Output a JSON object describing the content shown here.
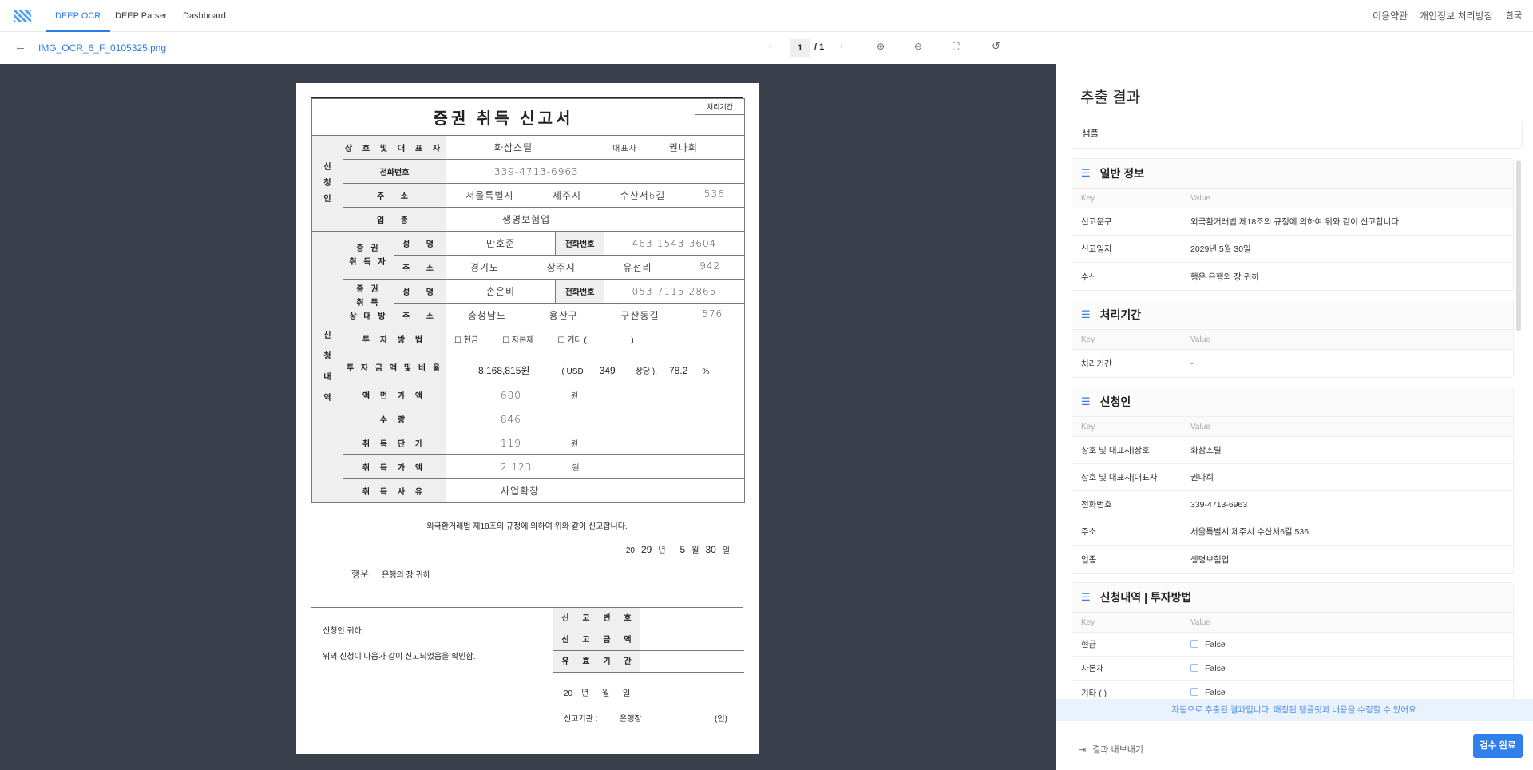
{
  "nav": {
    "tabs": [
      "DEEP OCR",
      "DEEP Parser",
      "Dashboard"
    ],
    "terms": "이용약관",
    "privacy": "개인정보 처리방침",
    "lang": "한국"
  },
  "toolbar": {
    "filename": "IMG_OCR_6_F_0105325.png",
    "page": "1",
    "total": "/ 1"
  },
  "doc": {
    "title": "증권 취득 신고서",
    "period_label": "처리기간",
    "applicant_group": "신\n청\n인",
    "detail_group": "신\n\n청\n\n내\n\n역",
    "l_company": "상 호 및 대 표 자",
    "company": "화삼스틸",
    "rep_label": "대표자",
    "rep": "권나희",
    "l_phone": "전화번호",
    "phone": "339-4713-6963",
    "l_addr": "주  소",
    "addr": [
      "서울특별시",
      "제주시",
      "수산서6길",
      "536"
    ],
    "l_biz": "업  종",
    "biz": "생명보험업",
    "buyer_group": "증 권\n취 득 자",
    "l_name": "성  명",
    "buyer_name": "만호준",
    "l_phone2": "전화번호",
    "buyer_phone": "463-1543-3604",
    "buyer_addr": [
      "경기도",
      "상주시",
      "유전리",
      "942"
    ],
    "counter_group": "증 권\n취 득\n상 대 방",
    "counter_name": "손은비",
    "counter_phone": "053-7115-2865",
    "counter_addr": [
      "충청남도",
      "용산구",
      "구산동길",
      "576"
    ],
    "l_method": "투 자 방 법",
    "methods": [
      "☐ 현금",
      "☐ 자본재",
      "☐ 기타 (                    )"
    ],
    "l_amount": "투 자 금 액 및 비 율",
    "amount": "8,168,815원",
    "usd_label": "( USD",
    "usd": "349",
    "equiv": "상당 ),",
    "ratio": "78.2",
    "pct": "%",
    "l_face": "액 면 가 액",
    "face": "600",
    "won": "원",
    "l_qty": "수 량",
    "qty": "846",
    "l_unit": "취 득 단 가",
    "unit": "119",
    "l_total": "취 득 가 액",
    "total": "2,123",
    "l_reason": "취 득 사 유",
    "reason": "사업확장",
    "statement": "외국환거래법 제18조의 규정에 의하여 위와 같이 신고합니다.",
    "date_line": [
      "20",
      "29",
      "년",
      "5",
      "월",
      "30",
      "일"
    ],
    "to_bank": "행운",
    "to_suffix": "은행의 장 귀하",
    "applicant_to": "신청인 귀하",
    "confirm": "위의 신청이 다음가 같이 신고되었음을 확인함.",
    "r_labels": [
      "신 고 번 호",
      "신 고 금 액",
      "유 효 기 간"
    ],
    "date_blank": "20    년      월      일",
    "org_label": "신고기관 :",
    "org": "은행장",
    "seal": "(인)"
  },
  "panel": {
    "title": "추출 결과",
    "template": "샘플",
    "key": "Key",
    "value": "Value",
    "sections": [
      {
        "title": "일반 정보",
        "rows": [
          [
            "신고문구",
            "외국환거래법 제18조의 규정에 의하여 위와 같이 신고합니다."
          ],
          [
            "신고일자",
            "2029년 5월 30일"
          ],
          [
            "수신",
            "행운 은행의 장 귀하"
          ]
        ]
      },
      {
        "title": "처리기간",
        "rows": [
          [
            "처리기간",
            "-"
          ]
        ]
      },
      {
        "title": "신청인",
        "rows": [
          [
            "상호 및 대표자|상호",
            "화삼스틸"
          ],
          [
            "상호 및 대표자|대표자",
            "권나희"
          ],
          [
            "전화번호",
            "339-4713-6963"
          ],
          [
            "주소",
            "서울특별시 제주시 수산서6길 536"
          ],
          [
            "업종",
            "생명보험업"
          ]
        ]
      },
      {
        "title": "신청내역 | 투자방법",
        "rows": [
          [
            "현금",
            "False"
          ],
          [
            "자본재",
            "False"
          ],
          [
            "기타 ( )",
            "False"
          ]
        ]
      }
    ],
    "notice": "자동으로 추출된 결과입니다. 매칭된 템플릿과 내용을 수정할 수 있어요.",
    "export": "결과 내보내기",
    "complete": "검수 완료"
  }
}
